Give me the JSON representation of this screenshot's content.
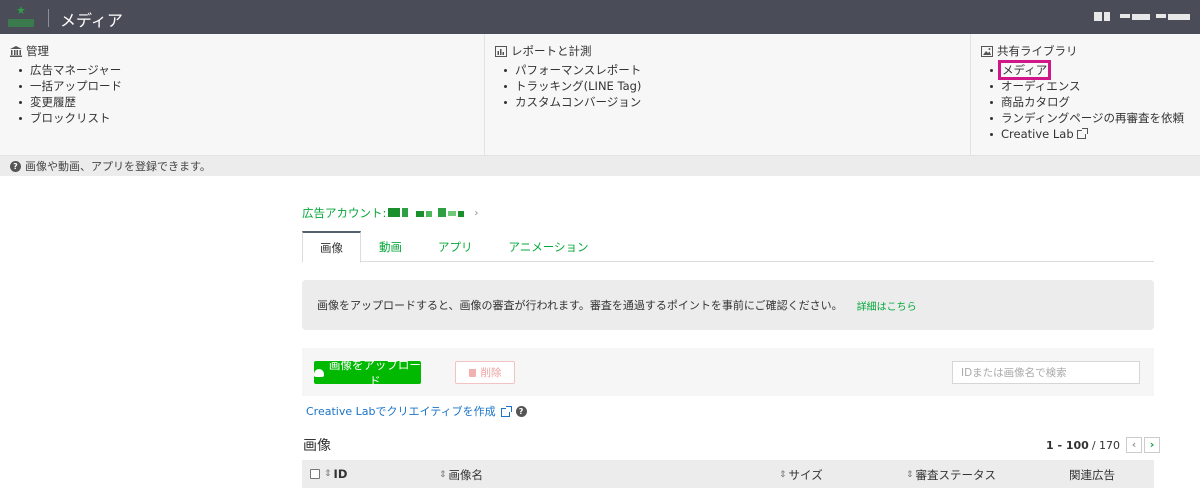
{
  "topbar": {
    "app_title": "メディア"
  },
  "menu": {
    "management": {
      "title": "管理",
      "items": [
        "広告マネージャー",
        "一括アップロード",
        "変更履歴",
        "ブロックリスト"
      ]
    },
    "reports": {
      "title": "レポートと計測",
      "items": [
        "パフォーマンスレポート",
        "トラッキング(LINE Tag)",
        "カスタムコンバージョン"
      ]
    },
    "library": {
      "title": "共有ライブラリ",
      "items": [
        "メディア",
        "オーディエンス",
        "商品カタログ",
        "ランディングページの再審査を依頼",
        "Creative Lab"
      ]
    }
  },
  "info_strip": {
    "text": "画像や動画、アプリを登録できます。"
  },
  "breadcrumb": {
    "label": "広告アカウント:"
  },
  "tabs": [
    "画像",
    "動画",
    "アプリ",
    "アニメーション"
  ],
  "notice": {
    "text": "画像をアップロードすると、画像の審査が行われます。審査を通過するポイントを事前にご確認ください。",
    "link": "詳細はこちら"
  },
  "toolbar": {
    "upload_label": "画像をアップロード",
    "delete_label": "削除",
    "search_placeholder": "IDまたは画像名で検索"
  },
  "creative_link": "Creative Labでクリエイティブを作成",
  "section": {
    "title": "画像"
  },
  "pagination": {
    "range": "1 - 100",
    "total": "/ 170"
  },
  "table": {
    "columns": [
      "ID",
      "画像名",
      "サイズ",
      "審査ステータス",
      "関連広告"
    ]
  },
  "colors": {
    "topbar": "#4a4d57",
    "accent_green": "#00b900",
    "link_green": "#06a83a",
    "highlight": "#d1168a",
    "link_blue": "#1a73c8"
  }
}
